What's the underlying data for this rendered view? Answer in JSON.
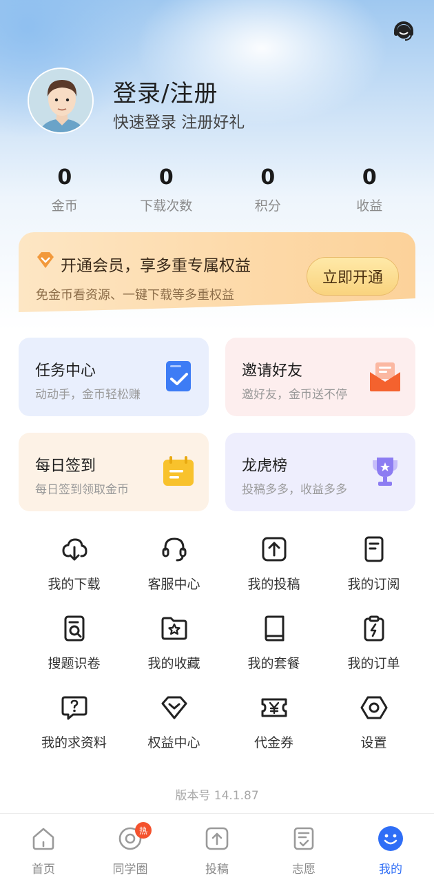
{
  "header": {
    "support_icon": "headset-icon"
  },
  "profile": {
    "avatar_icon": "avatar-man",
    "title": "登录/注册",
    "subtitle": "快速登录 注册好礼"
  },
  "stats": [
    {
      "value": "0",
      "label": "金币"
    },
    {
      "value": "0",
      "label": "下载次数"
    },
    {
      "value": "0",
      "label": "积分"
    },
    {
      "value": "0",
      "label": "收益"
    }
  ],
  "vip": {
    "icon": "diamond-icon",
    "title": "开通会员，享多重专属权益",
    "subtitle": "免金币看资源、一键下载等多重权益",
    "button": "立即开通",
    "accent": "#f2993b"
  },
  "cards": [
    {
      "title": "任务中心",
      "subtitle": "动动手，金币轻松赚",
      "icon": "task-check-icon",
      "color": "#3d7cf5"
    },
    {
      "title": "邀请好友",
      "subtitle": "邀好友，金币送不停",
      "icon": "envelope-icon",
      "color": "#f4622e"
    },
    {
      "title": "每日签到",
      "subtitle": "每日签到领取金币",
      "icon": "calendar-icon",
      "color": "#f8c22c"
    },
    {
      "title": "龙虎榜",
      "subtitle": "投稿多多，收益多多",
      "icon": "trophy-icon",
      "color": "#8c7cf2"
    }
  ],
  "grid": [
    {
      "label": "我的下载",
      "icon": "cloud-download-icon"
    },
    {
      "label": "客服中心",
      "icon": "headset-icon"
    },
    {
      "label": "我的投稿",
      "icon": "upload-icon"
    },
    {
      "label": "我的订阅",
      "icon": "document-icon"
    },
    {
      "label": "搜题识卷",
      "icon": "doc-search-icon"
    },
    {
      "label": "我的收藏",
      "icon": "folder-star-icon"
    },
    {
      "label": "我的套餐",
      "icon": "book-icon"
    },
    {
      "label": "我的订单",
      "icon": "clipboard-bolt-icon"
    },
    {
      "label": "我的求资料",
      "icon": "question-bubble-icon"
    },
    {
      "label": "权益中心",
      "icon": "diamond-outline-icon"
    },
    {
      "label": "代金券",
      "icon": "yen-ticket-icon"
    },
    {
      "label": "设置",
      "icon": "settings-icon"
    }
  ],
  "version": "版本号 14.1.87",
  "tabbar": [
    {
      "label": "首页",
      "icon": "home-icon"
    },
    {
      "label": "同学圈",
      "icon": "circle-icon",
      "badge": "热"
    },
    {
      "label": "投稿",
      "icon": "upload-square-icon"
    },
    {
      "label": "志愿",
      "icon": "checklist-icon"
    },
    {
      "label": "我的",
      "icon": "smile-icon",
      "active": true
    }
  ],
  "colors": {
    "active_tab": "#2f6ef6",
    "badge": "#f4522e"
  }
}
